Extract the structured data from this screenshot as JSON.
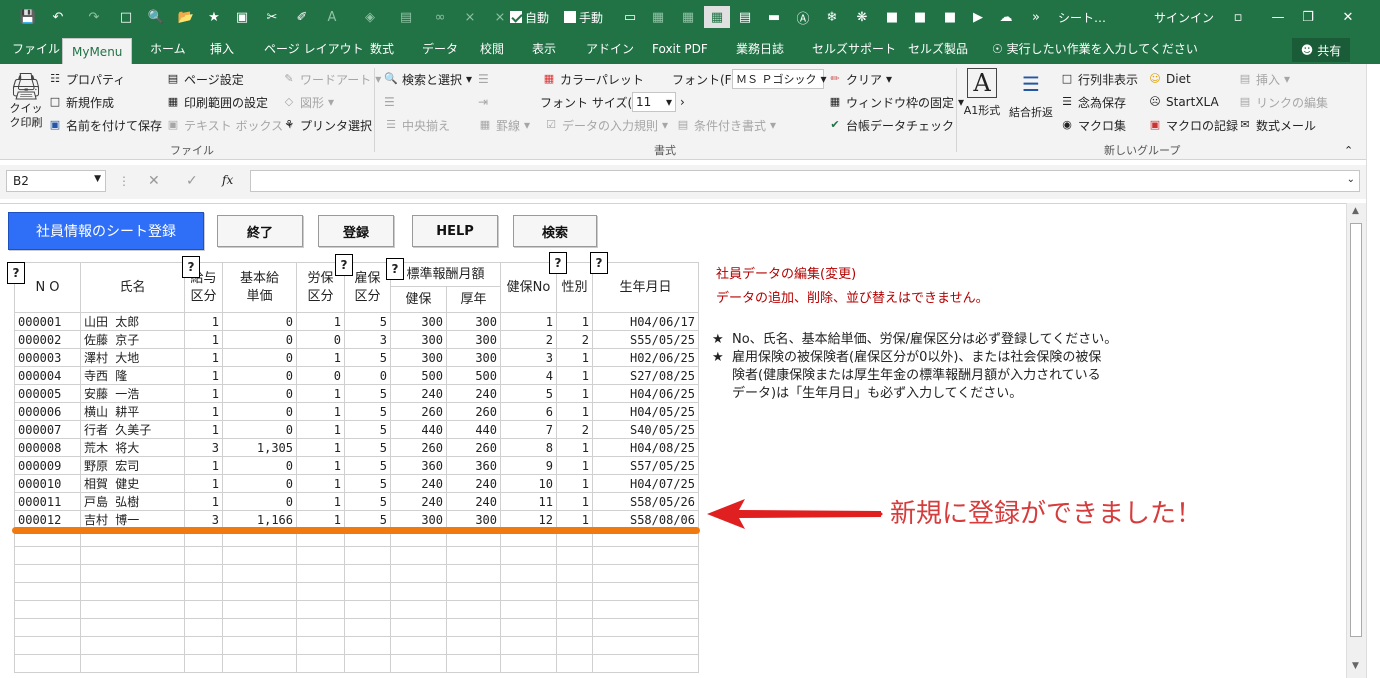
{
  "titlebar": {
    "auto_label": "自動",
    "manual_label": "手動",
    "title": "シート…",
    "signin": "サインイン"
  },
  "tabs": [
    "ファイル",
    "MyMenu",
    "ホーム",
    "挿入",
    "ページ レイアウト",
    "数式",
    "データ",
    "校閲",
    "表示",
    "アドイン",
    "Foxit PDF",
    "業務日誌",
    "セルズサポート",
    "セルズ製品"
  ],
  "tellme": "実行したい作業を入力してください",
  "share": "共有",
  "ribbon": {
    "quick_print": "クイック印刷",
    "properties": "プロパティ",
    "new_create": "新規作成",
    "save_as": "名前を付けて保存",
    "page_setup": "ページ設定",
    "print_area": "印刷範囲の設定",
    "textbox": "テキスト ボックス",
    "wordart": "ワードアート",
    "shapes": "図形",
    "printer": "プリンタ選択",
    "group_file": "ファイル",
    "search_select": "検索と選択",
    "center": "中央揃え",
    "border": "罫線",
    "validation": "データの入力規則",
    "cond_format": "条件付き書式",
    "color_palette": "カラーパレット",
    "font_label": "フォント(F):",
    "font_value": "ＭＳ Ｐゴシック",
    "font_size_label": "フォント サイズ(F):",
    "font_size_value": "11",
    "clear": "クリア",
    "freeze": "ウィンドウ枠の固定",
    "ledger_check": "台帳データチェック",
    "group_format": "書式",
    "a1_glyph": "A",
    "a1_format": "A1形式",
    "wrap": "結合折返",
    "row_col_show": "行列非表示",
    "just_in_case": "念為保存",
    "macro_collection": "マクロ集",
    "diet": "Diet",
    "startxla": "StartXLA",
    "macro_record": "マクロの記録",
    "insert": "挿入",
    "link_edit": "リンクの編集",
    "formula_mail": "数式メール",
    "group_new": "新しいグループ"
  },
  "formula_bar": {
    "name_box": "B2",
    "fx": "fx"
  },
  "buttons": {
    "register_sheet": "社員情報のシート登録",
    "end": "終了",
    "register": "登録",
    "help": "HELP",
    "search": "検索"
  },
  "help_mark": "?",
  "headers": {
    "no": "N O",
    "name": "氏名",
    "kyuyo": "給与",
    "kubun": "区分",
    "kihon": "基本給",
    "tanka": "単価",
    "rouho": "労保",
    "koho": "雇保",
    "hyojun": "標準報酬月額",
    "kenpo": "健保",
    "kounen": "厚年",
    "kenpo_no": "健保No",
    "sex": "性別",
    "birth": "生年月日"
  },
  "rows": [
    [
      "000001",
      "山田 太郎",
      "1",
      "0",
      "1",
      "5",
      "300",
      "300",
      "1",
      "1",
      "H04/06/17"
    ],
    [
      "000002",
      "佐藤 京子",
      "1",
      "0",
      "0",
      "3",
      "300",
      "300",
      "2",
      "2",
      "S55/05/25"
    ],
    [
      "000003",
      "澤村 大地",
      "1",
      "0",
      "1",
      "5",
      "300",
      "300",
      "3",
      "1",
      "H02/06/25"
    ],
    [
      "000004",
      "寺西 隆",
      "1",
      "0",
      "0",
      "0",
      "500",
      "500",
      "4",
      "1",
      "S27/08/25"
    ],
    [
      "000005",
      "安藤 一浩",
      "1",
      "0",
      "1",
      "5",
      "240",
      "240",
      "5",
      "1",
      "H04/06/25"
    ],
    [
      "000006",
      "横山 耕平",
      "1",
      "0",
      "1",
      "5",
      "260",
      "260",
      "6",
      "1",
      "H04/05/25"
    ],
    [
      "000007",
      "行者 久美子",
      "1",
      "0",
      "1",
      "5",
      "440",
      "440",
      "7",
      "2",
      "S40/05/25"
    ],
    [
      "000008",
      "荒木 将大",
      "3",
      "1,305",
      "1",
      "5",
      "260",
      "260",
      "8",
      "1",
      "H04/08/25"
    ],
    [
      "000009",
      "野原 宏司",
      "1",
      "0",
      "1",
      "5",
      "360",
      "360",
      "9",
      "1",
      "S57/05/25"
    ],
    [
      "000010",
      "相賀 健史",
      "1",
      "0",
      "1",
      "5",
      "240",
      "240",
      "10",
      "1",
      "H04/07/25"
    ],
    [
      "000011",
      "戸島 弘樹",
      "1",
      "0",
      "1",
      "5",
      "240",
      "240",
      "11",
      "1",
      "S58/05/26"
    ],
    [
      "000012",
      "吉村 博一",
      "3",
      "1,166",
      "1",
      "5",
      "300",
      "300",
      "12",
      "1",
      "S58/08/06"
    ]
  ],
  "notes": {
    "edit_title": "社員データの編集(変更)",
    "edit_sub": "データの追加、削除、並び替えはできません。",
    "star": "★",
    "note1": "No、氏名、基本給単価、労保/雇保区分は必ず登録してください。",
    "note2_l1": "雇用保険の被保険者(雇保区分が0以外)、または社会保険の被保",
    "note2_l2": "険者(健康保険または厚生年金の標準報酬月額が入力されている",
    "note2_l3": "データ)は「生年月日」も必ず入力してください。"
  },
  "annotation": "新規に登録ができました！",
  "colors": {
    "excel_green": "#217346",
    "arrow_red": "#e02020",
    "underline_orange": "#f07a10",
    "note_red": "#b40000",
    "button_blue": "#2f6ff7"
  }
}
